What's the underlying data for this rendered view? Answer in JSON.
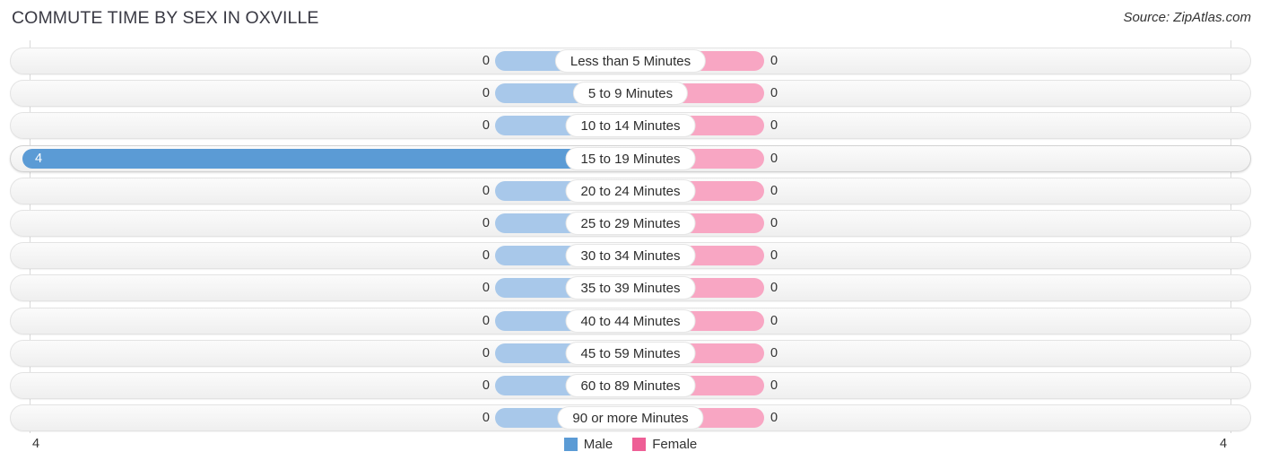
{
  "header": {
    "title": "COMMUTE TIME BY SEX IN OXVILLE",
    "source": "Source: ZipAtlas.com"
  },
  "legend": {
    "male_label": "Male",
    "female_label": "Female",
    "male_color": "#5b9bd5",
    "female_color": "#ee5f96"
  },
  "axis": {
    "left_label": "4",
    "right_label": "4"
  },
  "chart_data": {
    "type": "bar",
    "orientation": "horizontal-diverging",
    "title": "COMMUTE TIME BY SEX IN OXVILLE",
    "xlabel": "",
    "ylabel": "",
    "xlim": [
      4,
      4
    ],
    "grid": true,
    "legend_position": "bottom-center",
    "categories": [
      "Less than 5 Minutes",
      "5 to 9 Minutes",
      "10 to 14 Minutes",
      "15 to 19 Minutes",
      "20 to 24 Minutes",
      "25 to 29 Minutes",
      "30 to 34 Minutes",
      "35 to 39 Minutes",
      "40 to 44 Minutes",
      "45 to 59 Minutes",
      "60 to 89 Minutes",
      "90 or more Minutes"
    ],
    "series": [
      {
        "name": "Male",
        "color": "#5b9bd5",
        "values": [
          0,
          0,
          0,
          4,
          0,
          0,
          0,
          0,
          0,
          0,
          0,
          0
        ]
      },
      {
        "name": "Female",
        "color": "#ee5f96",
        "values": [
          0,
          0,
          0,
          0,
          0,
          0,
          0,
          0,
          0,
          0,
          0,
          0
        ]
      }
    ]
  },
  "rows": [
    {
      "label": "Less than 5 Minutes",
      "male_value": "0",
      "female_value": "0",
      "male_filled": false,
      "female_filled": false,
      "highlight": false
    },
    {
      "label": "5 to 9 Minutes",
      "male_value": "0",
      "female_value": "0",
      "male_filled": false,
      "female_filled": false,
      "highlight": false
    },
    {
      "label": "10 to 14 Minutes",
      "male_value": "0",
      "female_value": "0",
      "male_filled": false,
      "female_filled": false,
      "highlight": false
    },
    {
      "label": "15 to 19 Minutes",
      "male_value": "4",
      "female_value": "0",
      "male_filled": true,
      "female_filled": false,
      "highlight": true
    },
    {
      "label": "20 to 24 Minutes",
      "male_value": "0",
      "female_value": "0",
      "male_filled": false,
      "female_filled": false,
      "highlight": false
    },
    {
      "label": "25 to 29 Minutes",
      "male_value": "0",
      "female_value": "0",
      "male_filled": false,
      "female_filled": false,
      "highlight": false
    },
    {
      "label": "30 to 34 Minutes",
      "male_value": "0",
      "female_value": "0",
      "male_filled": false,
      "female_filled": false,
      "highlight": false
    },
    {
      "label": "35 to 39 Minutes",
      "male_value": "0",
      "female_value": "0",
      "male_filled": false,
      "female_filled": false,
      "highlight": false
    },
    {
      "label": "40 to 44 Minutes",
      "male_value": "0",
      "female_value": "0",
      "male_filled": false,
      "female_filled": false,
      "highlight": false
    },
    {
      "label": "45 to 59 Minutes",
      "male_value": "0",
      "female_value": "0",
      "male_filled": false,
      "female_filled": false,
      "highlight": false
    },
    {
      "label": "60 to 89 Minutes",
      "male_value": "0",
      "female_value": "0",
      "male_filled": false,
      "female_filled": false,
      "highlight": false
    },
    {
      "label": "90 or more Minutes",
      "male_value": "0",
      "female_value": "0",
      "male_filled": false,
      "female_filled": false,
      "highlight": false
    }
  ]
}
